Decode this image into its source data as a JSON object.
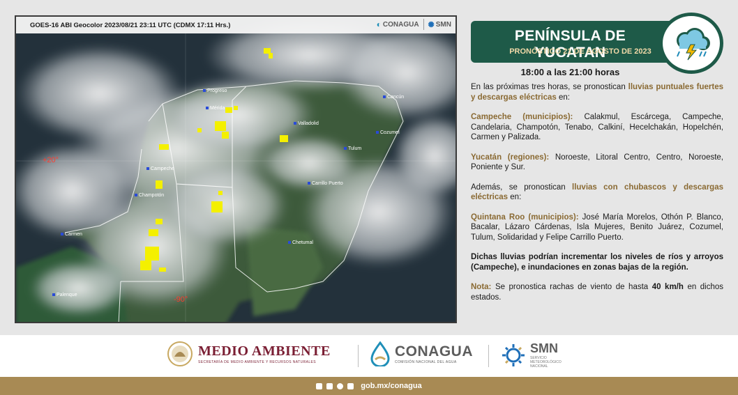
{
  "satellite": {
    "header": "GOES-16 ABI Geocolor 2023/08/21 23:11 UTC (CDMX  17:11 Hrs.)",
    "logo_conagua": "CONAGUA",
    "logo_smn": "SMN",
    "coord_lat": "+20°",
    "coord_lon": "-90°",
    "cities": [
      "Progreso",
      "Mérida",
      "Valladolid",
      "Cancún",
      "Cozumel",
      "Tulum",
      "Campeche",
      "Champotón",
      "Carrillo Puerto",
      "Carmen",
      "Chetumal",
      "Palenque"
    ]
  },
  "forecast": {
    "region_title": "PENÍNSULA DE YUCATAN",
    "subtitle": "PRONÓSTICO 21 DE AGOSTO DE 2023",
    "time_range": "18:00 a las 21:00 horas",
    "intro": "En las próximas tres horas, se pronostican",
    "intro_hl": "lluvias puntuales fuertes y descargas eléctricas",
    "intro_end": "en:",
    "campeche_label": "Campeche (municipios):",
    "campeche_list": "Calakmul, Escárcega, Campeche, Candelaria, Champotón, Tenabo, Calkiní, Hecelchakán, Hopelchén, Carmen y Palizada.",
    "yucatan_label": "Yucatán (regiones):",
    "yucatan_list": "Noroeste, Litoral Centro, Centro, Noroeste, Poniente y Sur.",
    "also": "Además, se pronostican",
    "also_hl": "lluvias con chubascos y descargas eléctricas",
    "also_end": "en:",
    "qroo_label": "Quintana Roo (municipios):",
    "qroo_list": "José María Morelos, Othón P. Blanco, Bacalar, Lázaro Cárdenas, Isla Mujeres, Benito Juárez, Cozumel, Tulum, Solidaridad y Felipe Carrillo Puerto.",
    "warning": "Dichas lluvias podrían incrementar los niveles de ríos y arroyos (Campeche), e inundaciones en zonas bajas de la región.",
    "note_label": "Nota:",
    "note_text": "Se pronostica rachas de viento de hasta",
    "note_value": "40 km/h",
    "note_end": "en dichos estados."
  },
  "footer": {
    "ma_main": "MEDIO AMBIENTE",
    "ma_sub": "SECRETARÍA DE MEDIO AMBIENTE Y RECURSOS NATURALES",
    "cg_main": "CONAGUA",
    "cg_sub": "COMISIÓN NACIONAL DEL AGUA",
    "smn_main": "SMN",
    "smn_sub1": "SERVICIO",
    "smn_sub2": "METEOROLÓGICO",
    "smn_sub3": "NACIONAL",
    "link": "gob.mx/conagua"
  },
  "colors": {
    "banner": "#1e5a48",
    "accent": "#8a6a33",
    "bottom_bar": "#a88a54",
    "lightning": "#f4f000"
  },
  "icons": [
    "storm-cloud-icon",
    "facebook-icon",
    "twitter-icon",
    "instagram-icon",
    "youtube-icon"
  ]
}
